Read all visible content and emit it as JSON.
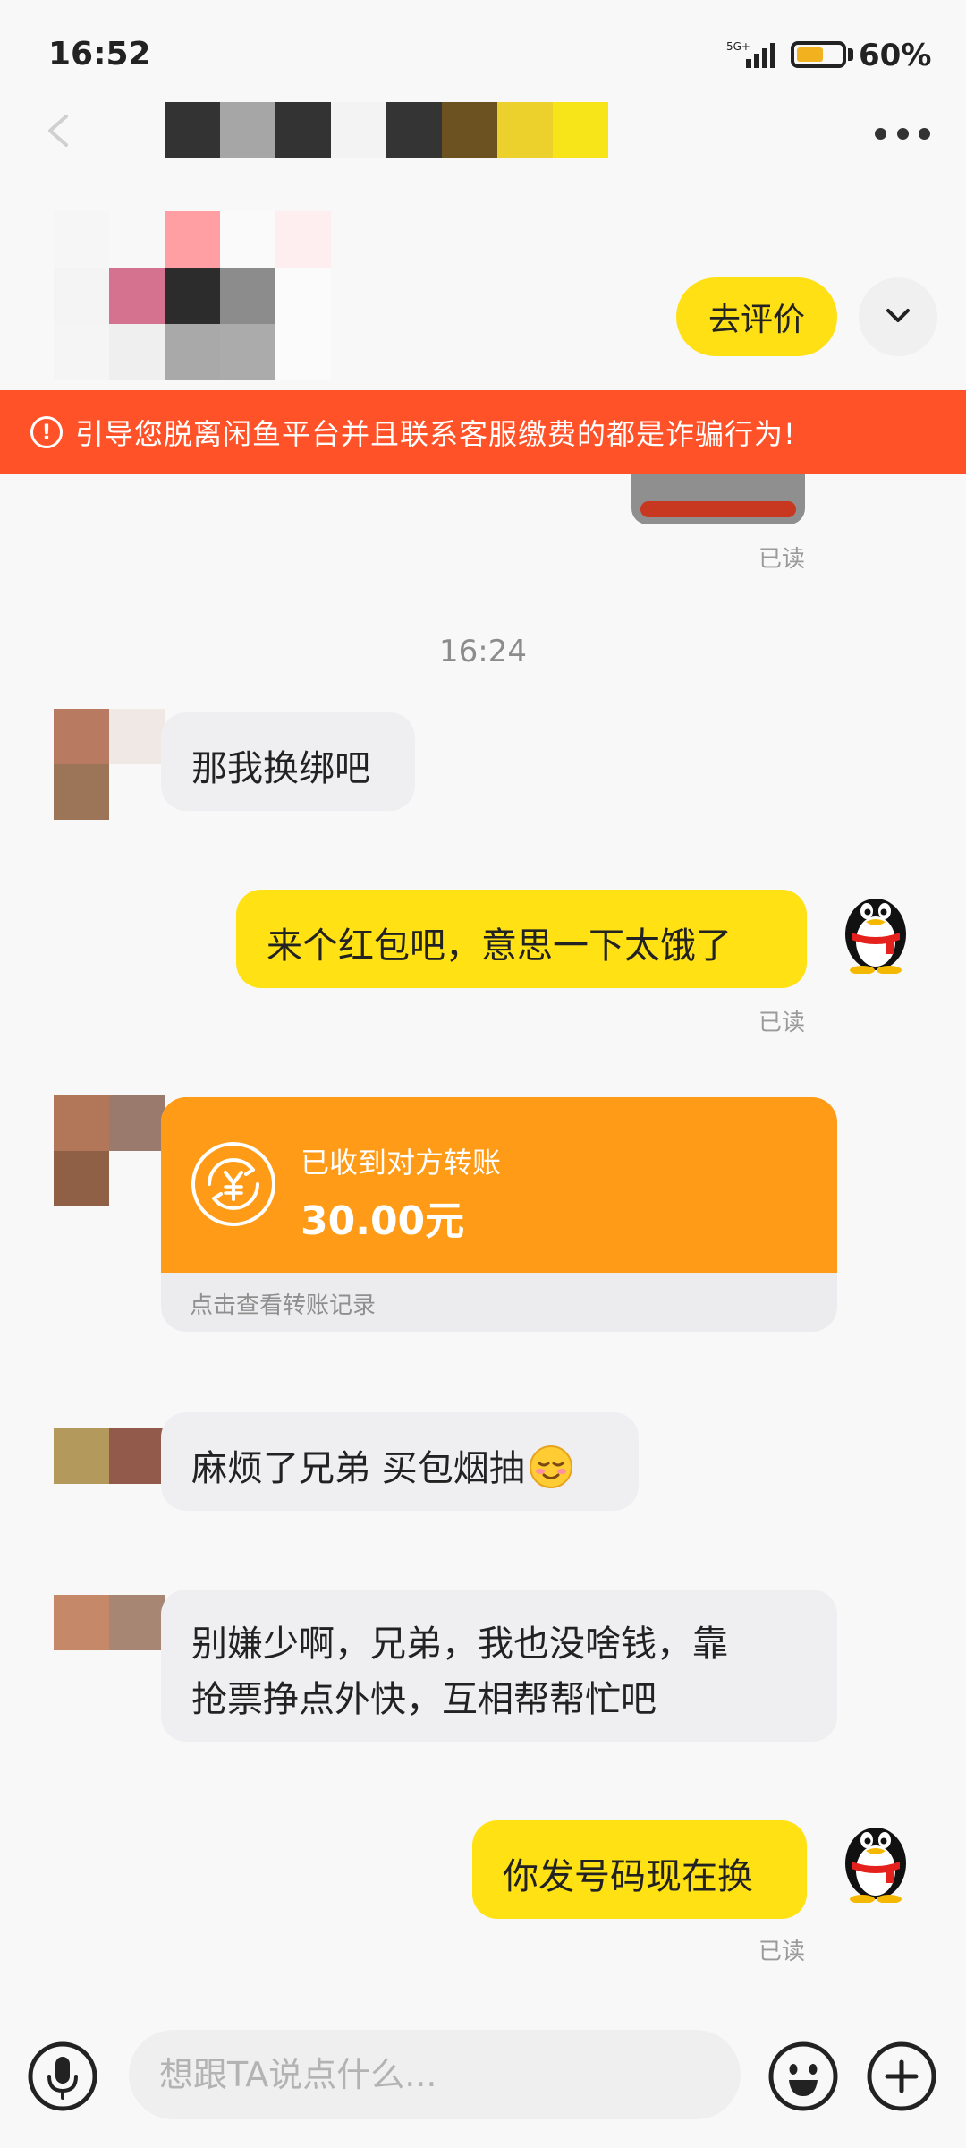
{
  "status_bar": {
    "time": "16:52",
    "network": "5G+",
    "battery_percent": "60%",
    "battery_level": 0.6
  },
  "header": {
    "review_button_label": "去评价",
    "warning_text": "引导您脱离闲鱼平台并且联系客服缴费的都是诈骗行为!",
    "warning_icon": "!"
  },
  "chat": {
    "read_label": "已读",
    "timestamp": "16:24",
    "messages": [
      {
        "side": "in",
        "text": "那我换绑吧"
      },
      {
        "side": "out",
        "text": "来个红包吧，意思一下太饿了"
      },
      {
        "side": "in",
        "text": "麻烦了兄弟 买包烟抽"
      },
      {
        "side": "in",
        "line1": "别嫌少啊，兄弟，我也没啥钱，靠",
        "line2": "抢票挣点外快，互相帮帮忙吧"
      },
      {
        "side": "out",
        "text": "你发号码现在换"
      }
    ],
    "transfer": {
      "title": "已收到对方转账",
      "amount": "30.00元",
      "footer": "点击查看转账记录",
      "icon": "yen-circle-icon"
    }
  },
  "input_bar": {
    "placeholder": "想跟TA说点什么..."
  },
  "colors": {
    "accent_yellow": "#ffe114",
    "warning_red": "#ff5228",
    "transfer_orange": "#ff9b17"
  }
}
